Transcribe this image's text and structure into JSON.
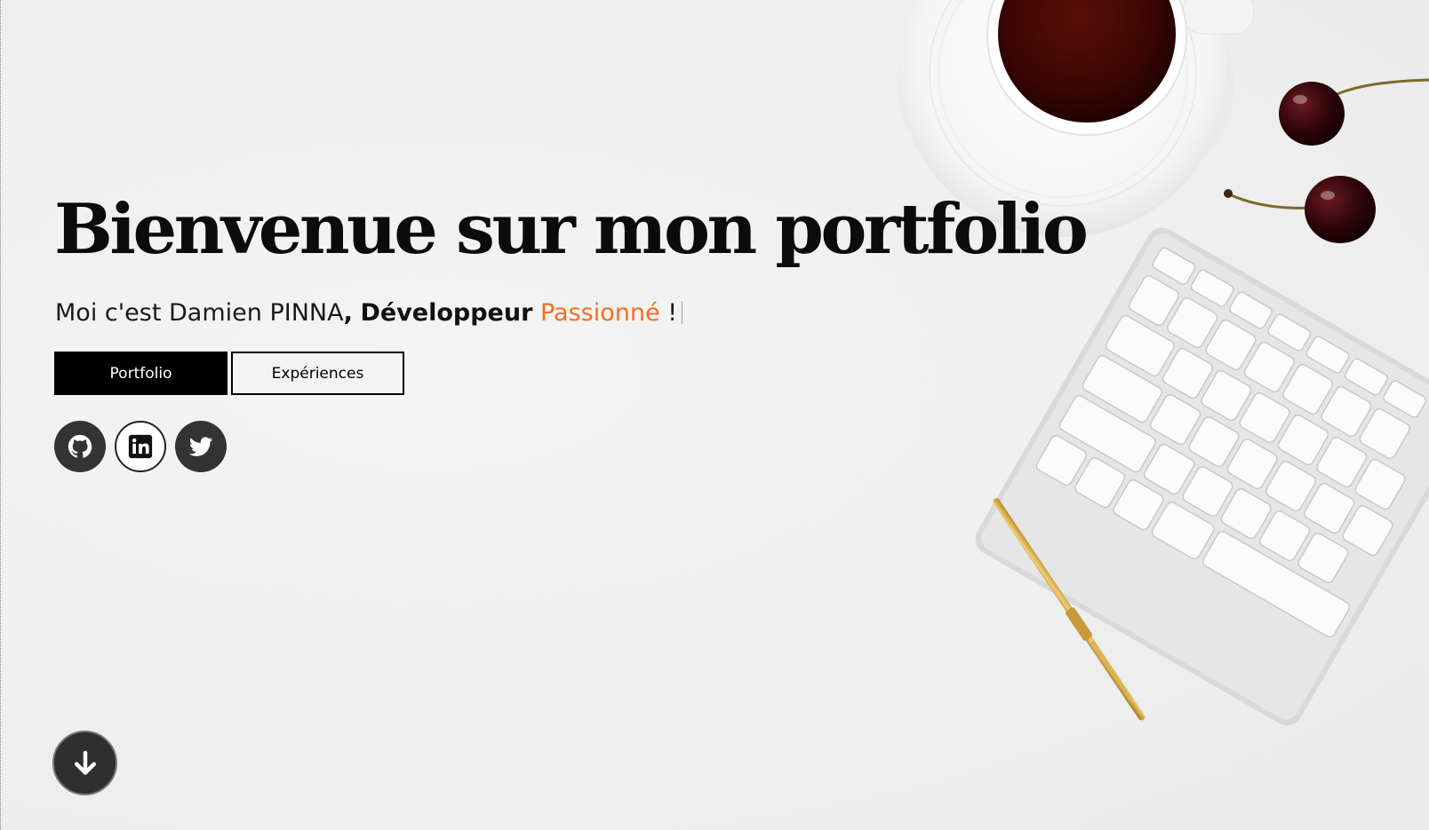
{
  "hero": {
    "title": "Bienvenue sur mon portfolio",
    "subtitle": {
      "intro": "Moi c'est Damien PINNA",
      "comma": ",",
      "role": "Développeur",
      "typed_word": "Passionné",
      "end": "!"
    }
  },
  "buttons": {
    "portfolio_label": "Portfolio",
    "experiences_label": "Expériences"
  },
  "social": [
    {
      "name": "github",
      "icon": "github-icon"
    },
    {
      "name": "linkedin",
      "icon": "linkedin-icon"
    },
    {
      "name": "twitter",
      "icon": "twitter-icon"
    }
  ],
  "scroll": {
    "icon": "arrow-down-icon"
  },
  "colors": {
    "accent": "#f36f21",
    "text": "#0b0b0b",
    "button_primary_bg": "#000000",
    "social_bg": "#333333"
  }
}
